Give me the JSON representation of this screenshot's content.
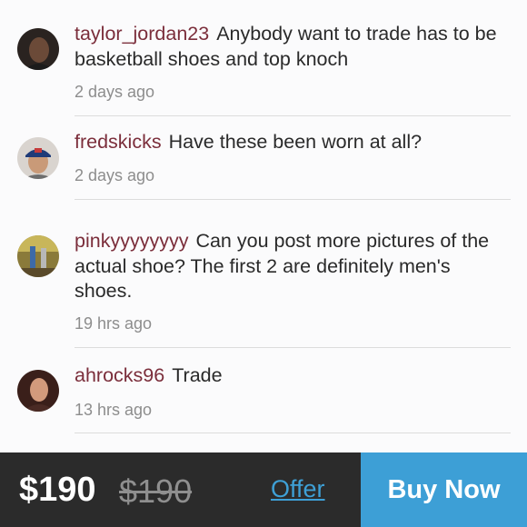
{
  "comments": [
    {
      "username": "taylor_jordan23",
      "text": "Anybody want to trade has to be basketball shoes and top knoch",
      "time": "2 days ago",
      "avatar": "person-avatar"
    },
    {
      "username": "fredskicks",
      "text": "Have these been worn at all?",
      "time": "2 days ago",
      "avatar": "person-avatar"
    },
    {
      "username": "pinkyyyyyyyy",
      "text": "Can you post more pictures of the actual shoe? The first 2 are definitely men's shoes.",
      "time": "19 hrs ago",
      "avatar": "person-avatar"
    },
    {
      "username": "ahrocks96",
      "text": "Trade",
      "time": "13 hrs ago",
      "avatar": "person-avatar"
    }
  ],
  "footer": {
    "price": "$190",
    "original_price": "$190",
    "offer_label": "Offer",
    "buy_label": "Buy Now"
  },
  "colors": {
    "username": "#7b2e3b",
    "accent": "#3d9fd6",
    "footer_bg": "#2b2b2b"
  }
}
